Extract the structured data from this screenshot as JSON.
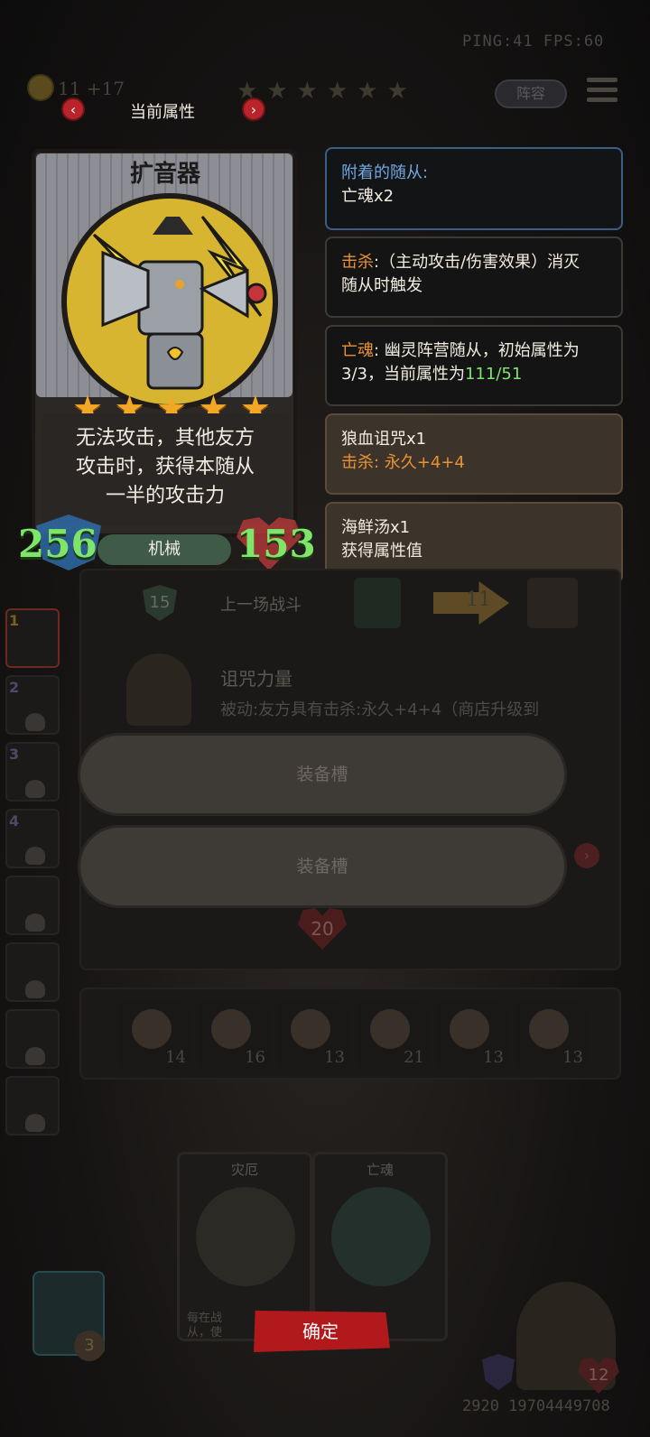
{
  "hud": {
    "ping_fps": "PING:41   FPS:60",
    "coins": "11 +17",
    "lineup_label": "阵容"
  },
  "attr_panel": {
    "title": "当前属性",
    "prev_arrow": "‹",
    "next_arrow": "›"
  },
  "card": {
    "name": "扩音器",
    "stars": 5,
    "description_lines": [
      "无法攻击，其他友方",
      "攻击时，获得本随从",
      "一半的攻击力"
    ],
    "attack": "256",
    "health": "153",
    "tribe": "机械"
  },
  "info": {
    "attached_label": "附着的随从:",
    "attached_value": "亡魂x2",
    "kill_keyword": "击杀",
    "kill_text": ":（主动攻击/伤害效果）消灭随从时触发",
    "kill_line1": ":（主动攻击/伤害效果）消灭",
    "kill_line2": "随从时触发",
    "ghost_keyword": "亡魂",
    "ghost_line1": ": 幽灵阵营随从，初始属性为",
    "ghost_line2a": "3/3，当前属性为",
    "ghost_current": "111/51",
    "curse_item_name": "狼血诅咒x1",
    "curse_item_kill": "击杀: ",
    "curse_item_effect": "永久+4+4",
    "soup_name": "海鲜汤x1",
    "soup_effect": "获得属性值"
  },
  "background_ui": {
    "shield_value": "15",
    "last_battle_label": "上一场战斗",
    "arrow_value": "11",
    "curse_power_title": "诅咒力量",
    "curse_power_desc": "被动:友方具有击杀:永久+4+4（商店升级到",
    "slot1_label": "装备槽",
    "slot2_label": "装备槽",
    "hidden_hp": "20",
    "side_numbers": [
      "1",
      "2",
      "3",
      "4"
    ],
    "items": [
      {
        "icon": "mirror-icon",
        "value": "14"
      },
      {
        "icon": "alarm-clock-icon",
        "value": "16"
      },
      {
        "icon": "teacup-icon",
        "value": "13"
      },
      {
        "icon": "cupcake-icon",
        "value": "21"
      },
      {
        "icon": "fish-icon",
        "value": "13"
      },
      {
        "icon": "clown-icon",
        "value": "13"
      }
    ],
    "bottom_card1_name": "灾厄",
    "bottom_card2_name": "亡魂",
    "bottom_card1_snippet": "每在战\n从，使",
    "confirm_label": "确定",
    "left_bottom_value": "3",
    "hero_hp": "12",
    "player_id": "2920 19704449708"
  },
  "colors": {
    "accent_blue": "#6fa8e0",
    "accent_orange": "#e89234",
    "stat_green": "#7ee46a",
    "confirm_red": "#b2191d"
  }
}
